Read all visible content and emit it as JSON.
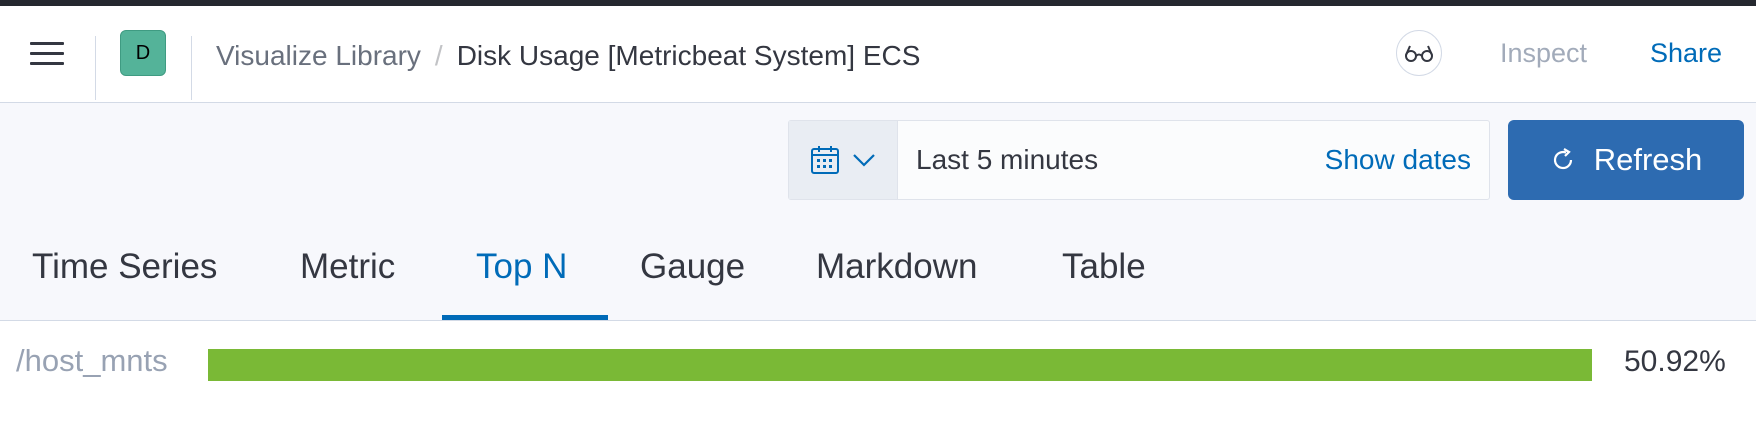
{
  "header": {
    "space_initial": "D",
    "breadcrumbs": [
      {
        "label": "Visualize Library"
      },
      {
        "label": "Disk Usage [Metricbeat System] ECS"
      }
    ],
    "breadcrumb_separator": "/",
    "inspect_label": "Inspect",
    "share_label": "Share",
    "space_color": "#54b399",
    "icons": {
      "menu": "hamburger-icon",
      "readonly": "glasses-icon"
    }
  },
  "query_bar": {
    "time_range": "Last 5 minutes",
    "show_dates_label": "Show dates",
    "refresh_label": "Refresh",
    "accent_color": "#2d6bb1",
    "icons": {
      "calendar": "calendar-icon",
      "chevron": "chevron-down-icon",
      "refresh": "refresh-icon"
    }
  },
  "tabs": [
    {
      "label": "Time Series",
      "active": false
    },
    {
      "label": "Metric",
      "active": false
    },
    {
      "label": "Top N",
      "active": true
    },
    {
      "label": "Gauge",
      "active": false
    },
    {
      "label": "Markdown",
      "active": false
    },
    {
      "label": "Table",
      "active": false
    }
  ],
  "topn": {
    "items": [
      {
        "label": "/host_mnts",
        "value_text": "50.92%",
        "bar_fraction": 1.0,
        "color": "#7ab936"
      }
    ]
  }
}
